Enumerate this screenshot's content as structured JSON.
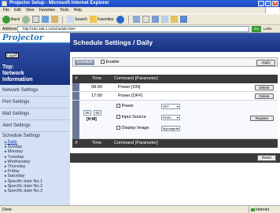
{
  "window": {
    "title": "Projector Setup - Microsoft Internet Explorer",
    "controls": {
      "minimize": "_",
      "maximize": "□",
      "close": "x"
    }
  },
  "menu": [
    "File",
    "Edit",
    "View",
    "Favorites",
    "Tools",
    "Help"
  ],
  "toolbar": {
    "back": "Back",
    "search": "Search",
    "favorites": "Favorites"
  },
  "address": {
    "label": "Address",
    "value": "http://192.168.1.10/schedule.html",
    "go": "Go",
    "links": "Links"
  },
  "sidebar": {
    "logo": "Projector Setup",
    "logoff": "Logoff",
    "top_label_1": "Top:",
    "top_label_2": "Network",
    "top_label_3": "Information",
    "items": [
      "Network Settings",
      "Port Settings",
      "Mail Settings",
      "Alert Settings"
    ],
    "schedule_title": "Schedule Settings",
    "schedule_items": [
      "Daily",
      "Sunday",
      "Monday",
      "Tuesday",
      "Wednesday",
      "Thursday",
      "Friday",
      "Saturday",
      "Specific date No.1",
      "Specific date No.2",
      "Specific date No.3"
    ]
  },
  "main": {
    "title": "Schedule Settings / Daily",
    "schedule_label": "Schedule",
    "enable_label": "Enable",
    "apply_label": "Apply",
    "table": {
      "headers": {
        "hash": "#",
        "time": "Time",
        "command": "Command [Parameter]"
      },
      "rows": [
        {
          "time": "08:00",
          "command": "Power [ON]",
          "action": "Delete"
        },
        {
          "time": "17:00",
          "command": "Power [OFF]",
          "action": "Delete"
        }
      ],
      "edit": {
        "hour": "00",
        "minute": "00",
        "ampm": "[H:M]",
        "power_label": "Power",
        "power_value": "OFF",
        "input_label": "Input Source",
        "input_value": "RGB1",
        "display_label": "Display Image",
        "display_value": "MyImage1",
        "register_label": "Register"
      }
    },
    "reset_label": "Reset"
  },
  "status": {
    "left": "Done",
    "right": "Internet"
  }
}
